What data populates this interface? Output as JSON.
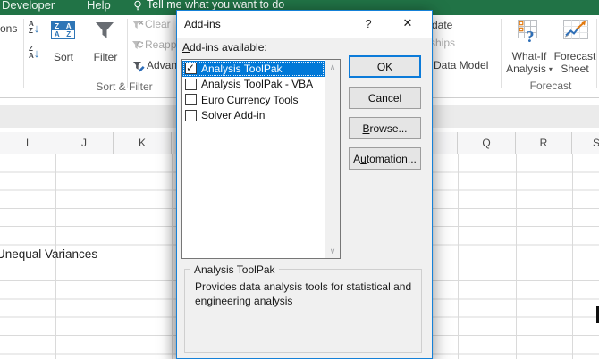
{
  "window": {
    "tabs": [
      "Developer",
      "Help"
    ],
    "tell_me": "Tell me what you want to do"
  },
  "ribbon": {
    "connections_fragment": "ons",
    "sort_group": {
      "asc_icon": {
        "top": "A",
        "bottom": "Z"
      },
      "desc_icon": {
        "top": "Z",
        "bottom": "A"
      },
      "sort_icon_letters": {
        "tl": "Z",
        "tr": "A",
        "bl": "A",
        "br": "Z"
      },
      "sort": "Sort",
      "filter": "Filter",
      "clear": "Clear",
      "reapply": "Reapp",
      "advanced": "Advan",
      "group_label": "Sort & Filter"
    },
    "data_tools": {
      "consolidate_fragment": "date",
      "relationships_fragment": "ships",
      "data_model": "Data Model"
    },
    "forecast_group": {
      "what_if_line1": "What-If",
      "what_if_line2": "Analysis",
      "forecast_line1": "Forecast",
      "forecast_line2": "Sheet",
      "group_label": "Forecast"
    }
  },
  "sheet": {
    "columns_left": [
      "I",
      "J",
      "K"
    ],
    "columns_right": [
      "Q",
      "R",
      "S"
    ],
    "cell_text": "Unequal Variances"
  },
  "dialog": {
    "title": "Add-ins",
    "help_glyph": "?",
    "close_glyph": "✕",
    "available_label": {
      "mnemonic": "A",
      "rest": "dd-ins available:"
    },
    "items": [
      {
        "label": "Analysis ToolPak",
        "checked": true,
        "selected": true
      },
      {
        "label": "Analysis ToolPak - VBA",
        "checked": false,
        "selected": false
      },
      {
        "label": "Euro Currency Tools",
        "checked": false,
        "selected": false
      },
      {
        "label": "Solver Add-in",
        "checked": false,
        "selected": false
      }
    ],
    "buttons": {
      "ok": "OK",
      "cancel": "Cancel",
      "browse": {
        "mnemonic": "B",
        "rest": "rowse..."
      },
      "automation": {
        "pre": "A",
        "mnemonic": "u",
        "rest": "tomation..."
      }
    },
    "info": {
      "title": "Analysis ToolPak",
      "description_lines": [
        "Provides data analysis tools for statistical and",
        "engineering analysis"
      ]
    }
  },
  "colors": {
    "excel_green": "#217346",
    "selection_blue": "#0078d7"
  }
}
